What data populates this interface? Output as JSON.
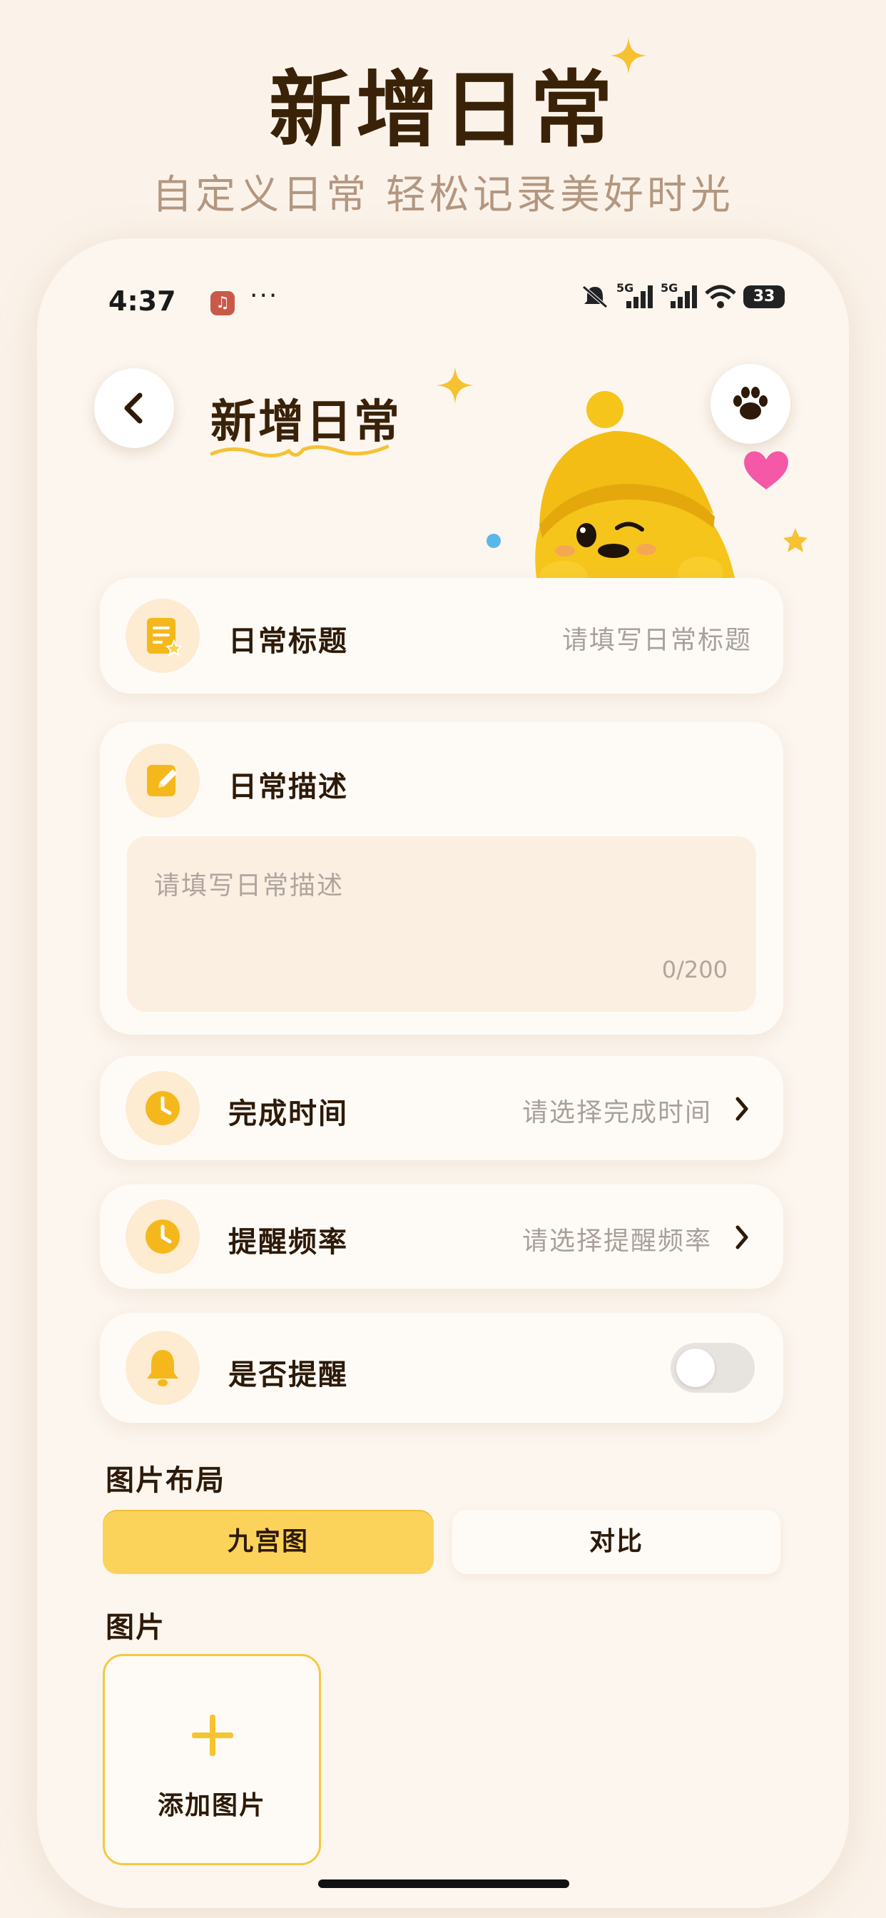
{
  "hero": {
    "title": "新增日常",
    "subtitle": "自定义日常 轻松记录美好时光"
  },
  "status_bar": {
    "time": "4:37",
    "more": "···",
    "signal1_label": "5G",
    "signal2_label": "5G",
    "battery": "33"
  },
  "header": {
    "title": "新增日常"
  },
  "form": {
    "title_row": {
      "label": "日常标题",
      "placeholder": "请填写日常标题"
    },
    "desc_row": {
      "label": "日常描述",
      "placeholder": "请填写日常描述",
      "counter": "0/200"
    },
    "time_row": {
      "label": "完成时间",
      "placeholder": "请选择完成时间"
    },
    "freq_row": {
      "label": "提醒频率",
      "placeholder": "请选择提醒频率"
    },
    "remind_row": {
      "label": "是否提醒",
      "enabled": false
    }
  },
  "layout_section": {
    "label": "图片布局",
    "options": [
      "九宫图",
      "对比"
    ],
    "selected": "九宫图"
  },
  "images_section": {
    "label": "图片",
    "add_label": "添加图片"
  },
  "colors": {
    "accent": "#f9c943",
    "background": "#fbf3ea",
    "card": "#fefbf7",
    "text_dark": "#2e1a08",
    "placeholder": "#a9a09a"
  },
  "icons": {
    "back": "chevron-left-icon",
    "paw": "paw-icon",
    "title": "document-star-icon",
    "desc": "edit-note-icon",
    "time": "clock-icon",
    "freq": "clock-icon",
    "remind": "bell-icon",
    "chevron": "chevron-right-icon",
    "add": "plus-icon"
  }
}
